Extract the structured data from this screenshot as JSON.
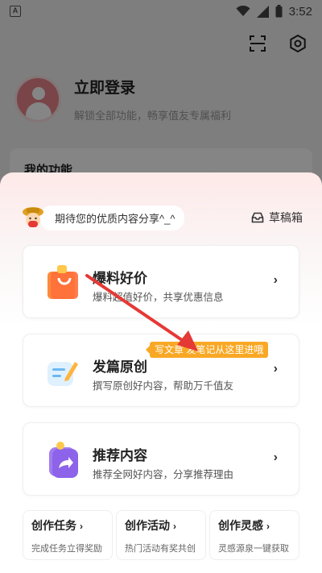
{
  "status_bar": {
    "left_icon_letter": "A",
    "time": "3:52"
  },
  "profile": {
    "title": "立即登录",
    "subtitle": "解锁全部功能，畅享值友专属福利"
  },
  "functions_title": "我的功能",
  "sheet": {
    "hint": "期待您的优质内容分享^_^",
    "drafts_label": "草稿箱",
    "options": [
      {
        "title": "爆料好价",
        "desc": "爆料超值好价，共享优惠信息",
        "icon": "shopping-bag-icon"
      },
      {
        "title": "发篇原创",
        "desc": "撰写原创好内容，帮助万千值友",
        "icon": "edit-note-icon"
      },
      {
        "title": "推荐内容",
        "desc": "推荐全网好内容，分享推荐理由",
        "icon": "share-forward-icon"
      }
    ],
    "tooltip": "写文章 发笔记从这里进哦",
    "mini_cards": [
      {
        "title": "创作任务",
        "desc": "完成任务立得奖励"
      },
      {
        "title": "创作活动",
        "desc": "热门活动有奖共创"
      },
      {
        "title": "创作灵感",
        "desc": "灵感源泉一键获取"
      }
    ]
  },
  "colors": {
    "accent": "#f9a825",
    "annotation_arrow": "#e53935",
    "avatar": "#e9858a"
  }
}
